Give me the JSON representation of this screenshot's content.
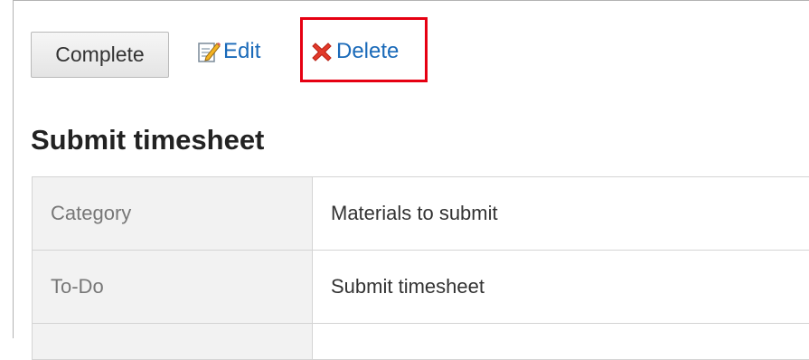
{
  "toolbar": {
    "complete_label": "Complete",
    "edit_label": "Edit",
    "delete_label": "Delete",
    "edit_icon": "edit-icon",
    "delete_icon": "delete-icon"
  },
  "page_title": "Submit timesheet",
  "details": {
    "rows": [
      {
        "label": "Category",
        "value": "Materials to submit"
      },
      {
        "label": "To-Do",
        "value": "Submit timesheet"
      }
    ]
  },
  "colors": {
    "link": "#1a6ab9",
    "highlight": "#e60012",
    "delete_icon": "#e23a2a"
  }
}
